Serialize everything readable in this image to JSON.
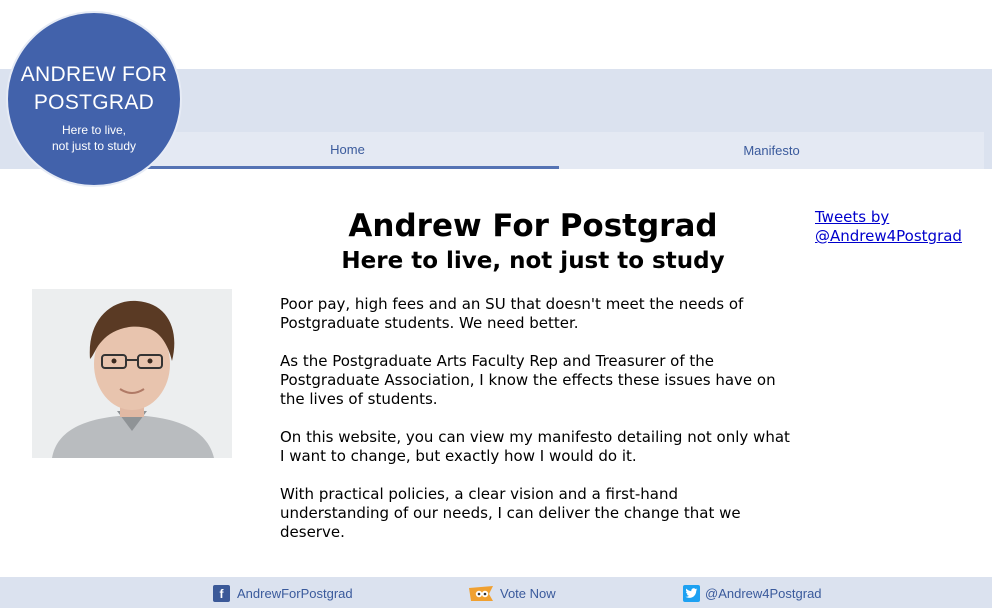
{
  "logo": {
    "title_line1": "ANDREW FOR",
    "title_line2": "POSTGRAD",
    "tagline_line1": "Here to live,",
    "tagline_line2": "not just to study"
  },
  "nav": {
    "home": "Home",
    "manifesto": "Manifesto",
    "active": "Home"
  },
  "main": {
    "title": "Andrew For Postgrad",
    "subtitle": "Here to live, not just to study",
    "paragraphs": [
      "Poor pay, high fees and an SU that doesn't meet the needs of Postgraduate students. We need better.",
      "As the Postgraduate Arts Faculty Rep and Treasurer of the Postgraduate Association, I know the effects these issues have on the lives of students.",
      "On this website, you can view my manifesto detailing not only what I want to change, but exactly how I would do it.",
      "With practical policies, a clear vision and a first-hand understanding of our needs, I can deliver the change that we deserve."
    ]
  },
  "sidebar": {
    "tweets_link": "Tweets by @Andrew4Postgrad"
  },
  "footer": {
    "facebook_label": "AndrewForPostgrad",
    "facebook_icon": "facebook-icon",
    "vote_label": "Vote Now",
    "vote_icon": "vote-icon",
    "twitter_label": "@Andrew4Postgrad",
    "twitter_icon": "twitter-icon"
  },
  "colors": {
    "brand_blue": "#4262ab",
    "band": "#dbe2ef",
    "link": "#3a5a9c"
  }
}
